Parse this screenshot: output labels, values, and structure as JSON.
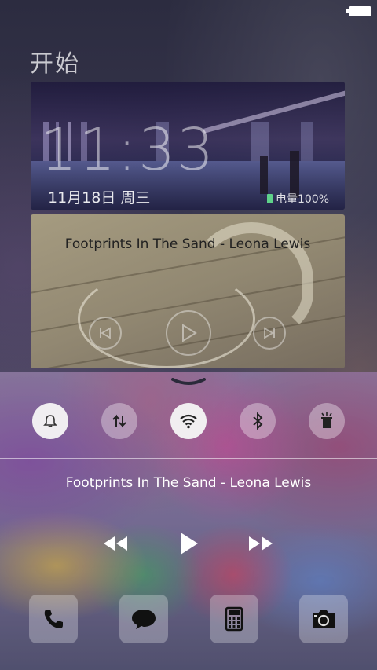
{
  "home": {
    "title": "开始"
  },
  "clock_widget": {
    "time": "11:33",
    "date": "11月18日  周三",
    "battery_label": "电量100%"
  },
  "music_widget": {
    "song": "Footprints In The Sand - Leona Lewis",
    "controls": [
      "previous-icon",
      "play-icon",
      "next-icon"
    ]
  },
  "control_center": {
    "toggles": [
      {
        "name": "notification",
        "icon": "bell-icon",
        "state": "on"
      },
      {
        "name": "data-sync",
        "icon": "data-sync-icon",
        "state": "off"
      },
      {
        "name": "wifi",
        "icon": "wifi-icon",
        "state": "on"
      },
      {
        "name": "bluetooth",
        "icon": "bluetooth-icon",
        "state": "off"
      },
      {
        "name": "flashlight",
        "icon": "flashlight-icon",
        "state": "off"
      }
    ],
    "now_playing": "Footprints In The Sand - Leona Lewis",
    "player_controls": [
      "rewind-icon",
      "play-icon",
      "fast-forward-icon"
    ],
    "dock": [
      "phone-icon",
      "message-icon",
      "calculator-icon",
      "camera-icon"
    ]
  },
  "colors": {
    "battery_accent": "#5fd28a",
    "toggle_on": "#f5f5f5"
  }
}
